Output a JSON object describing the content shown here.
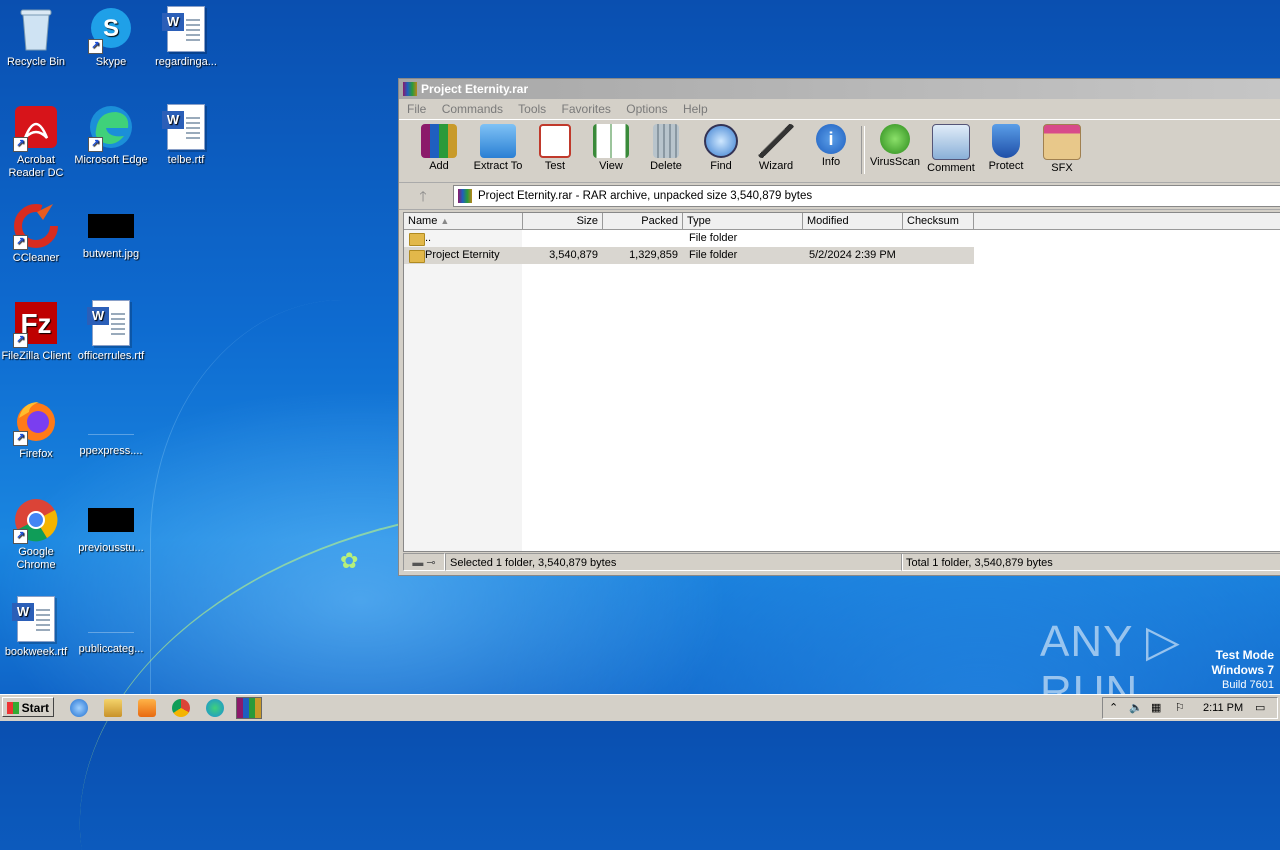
{
  "desktop": {
    "icons": [
      {
        "label": "Recycle Bin"
      },
      {
        "label": "Skype"
      },
      {
        "label": "regardinga..."
      },
      {
        "label": "Acrobat Reader DC"
      },
      {
        "label": "Microsoft Edge"
      },
      {
        "label": "telbe.rtf"
      },
      {
        "label": "CCleaner"
      },
      {
        "label": "butwent.jpg"
      },
      {
        "label": "FileZilla Client"
      },
      {
        "label": "officerrules.rtf"
      },
      {
        "label": "Firefox"
      },
      {
        "label": "ppexpress...."
      },
      {
        "label": "Google Chrome"
      },
      {
        "label": "previousstu..."
      },
      {
        "label": "bookweek.rtf"
      },
      {
        "label": "publiccateg..."
      }
    ]
  },
  "window": {
    "title": "Project Eternity.rar",
    "menu": [
      "File",
      "Commands",
      "Tools",
      "Favorites",
      "Options",
      "Help"
    ],
    "toolbar": [
      "Add",
      "Extract To",
      "Test",
      "View",
      "Delete",
      "Find",
      "Wizard",
      "Info",
      "VirusScan",
      "Comment",
      "Protect",
      "SFX"
    ],
    "address": "Project Eternity.rar - RAR archive, unpacked size 3,540,879 bytes",
    "columns": [
      "Name",
      "Size",
      "Packed",
      "Type",
      "Modified",
      "Checksum"
    ],
    "rows": [
      {
        "name": "..",
        "size": "",
        "packed": "",
        "type": "File folder",
        "modified": "",
        "checksum": ""
      },
      {
        "name": "Project Eternity",
        "size": "3,540,879",
        "packed": "1,329,859",
        "type": "File folder",
        "modified": "5/2/2024 2:39 PM",
        "checksum": ""
      }
    ],
    "status_left": "Selected 1 folder, 3,540,879 bytes",
    "status_right": "Total 1 folder, 3,540,879 bytes"
  },
  "taskbar": {
    "start_label": "Start",
    "time": "2:11 PM"
  },
  "watermark": {
    "brand": "ANY ▷ RUN",
    "line1": "Test Mode",
    "line2": "Windows 7",
    "line3": "Build 7601"
  },
  "colors": {
    "desktop": "#0e6bd0",
    "window_bg": "#d4d0c8",
    "selected_row": "#d9d6d0"
  }
}
